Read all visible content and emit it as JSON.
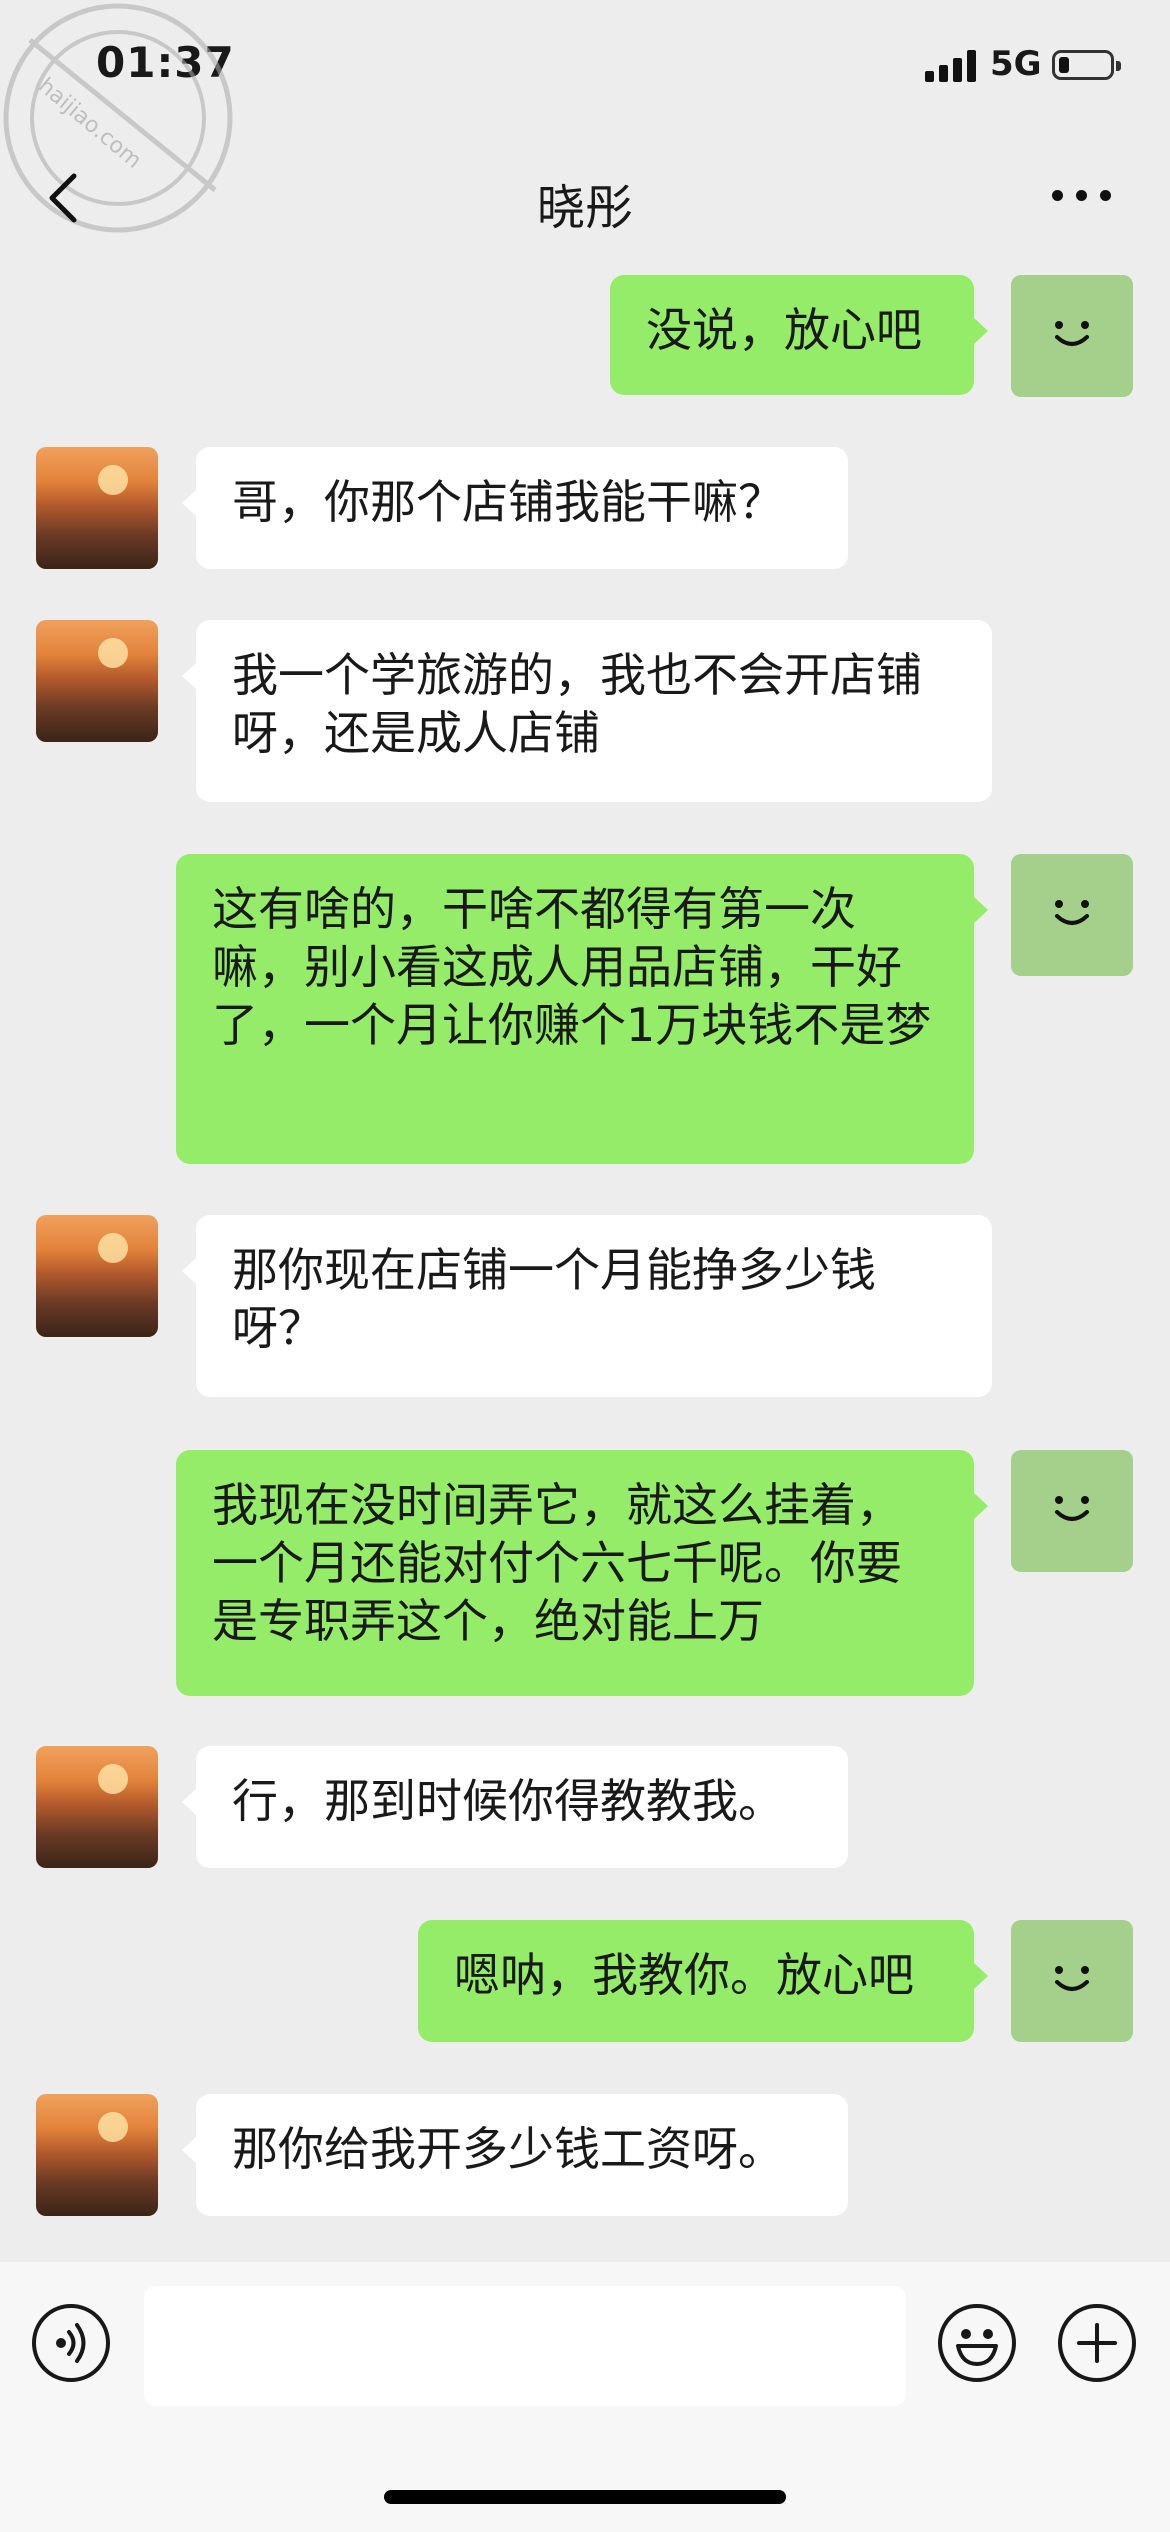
{
  "status_bar": {
    "time": "01:37",
    "network": "5G",
    "signal_bars": 4,
    "battery_level_pct": 15
  },
  "watermark": {
    "text": "haijiao.com 海角社区"
  },
  "nav": {
    "title": "晓彤",
    "back_icon": "chevron-left-icon",
    "more_icon": "more-dots-icon"
  },
  "messages": [
    {
      "from": "me",
      "text": "没说，放心吧"
    },
    {
      "from": "other",
      "text": "哥，你那个店铺我能干嘛？"
    },
    {
      "from": "other",
      "text": "我一个学旅游的，我也不会开店铺呀，还是成人店铺"
    },
    {
      "from": "me",
      "text": "这有啥的，干啥不都得有第一次嘛，别小看这成人用品店铺，干好了，一个月让你赚个1万块钱不是梦"
    },
    {
      "from": "other",
      "text": "那你现在店铺一个月能挣多少钱呀？"
    },
    {
      "from": "me",
      "text": "我现在没时间弄它，就这么挂着，一个月还能对付个六七千呢。你要是专职弄这个，绝对能上万"
    },
    {
      "from": "other",
      "text": "行，那到时候你得教教我。"
    },
    {
      "from": "me",
      "text": "嗯呐，我教你。放心吧"
    },
    {
      "from": "other",
      "text": "那你给我开多少钱工资呀。"
    }
  ],
  "input_bar": {
    "voice_icon": "voice-icon",
    "emoji_icon": "emoji-icon",
    "plus_icon": "plus-icon",
    "input_value": ""
  },
  "colors": {
    "background": "#ededed",
    "outgoing_bubble": "#95ec69",
    "incoming_bubble": "#ffffff",
    "self_avatar": "#a5d08c"
  }
}
